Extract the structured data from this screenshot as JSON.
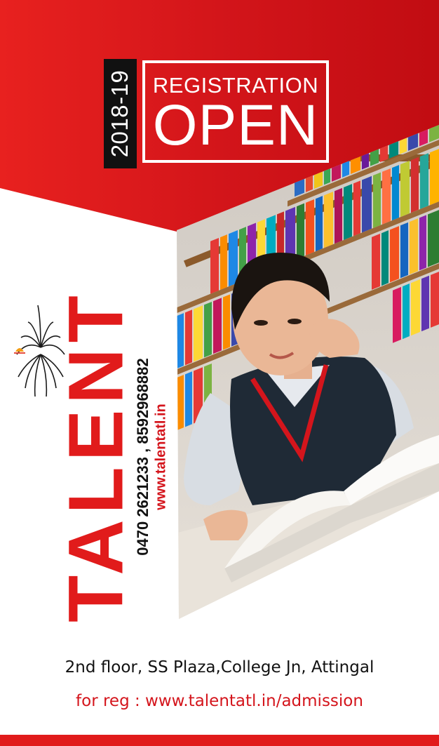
{
  "badge": {
    "year": "2018-19",
    "title_top": "REGISTRATION",
    "title_main": "OPEN"
  },
  "brand": {
    "name": "TALENT",
    "logo_icon": "open-book-with-rising-sun",
    "phones": "0470 2621233 , 8592968882",
    "website": "www.talentatl.in"
  },
  "footer": {
    "address": "2nd floor, SS Plaza,College Jn, Attingal",
    "registration": "for reg : www.talentatl.in/admission"
  },
  "photo": {
    "subject": "student-reading-in-library-icon"
  },
  "colors": {
    "brand_red": "#e11b1b",
    "dark_red": "#c30d12",
    "text_dark": "#111111",
    "white": "#ffffff"
  }
}
